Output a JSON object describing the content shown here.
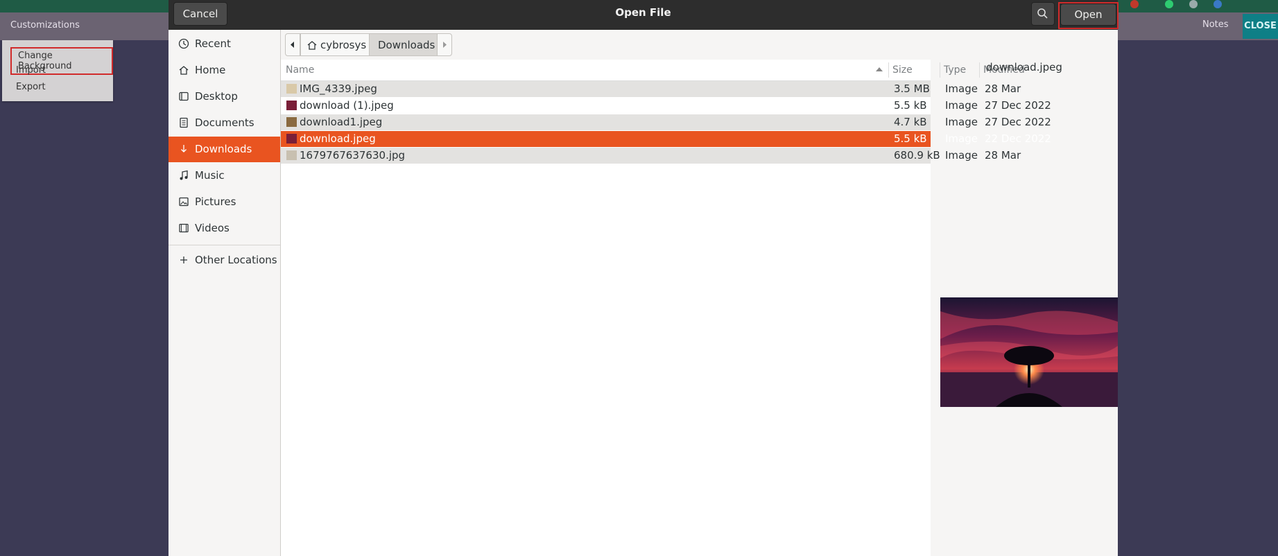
{
  "background_app": {
    "app_title": "Customizations",
    "notes_label": "Notes",
    "close_label": "CLOSE",
    "menu": {
      "items": [
        "Change Background",
        "Import",
        "Export"
      ]
    }
  },
  "dialog": {
    "title": "Open File",
    "cancel_label": "Cancel",
    "open_label": "Open",
    "search_icon": "search-icon",
    "sidebar": {
      "items": [
        {
          "label": "Recent",
          "icon": "clock-icon"
        },
        {
          "label": "Home",
          "icon": "home-icon"
        },
        {
          "label": "Desktop",
          "icon": "desktop-icon"
        },
        {
          "label": "Documents",
          "icon": "document-icon"
        },
        {
          "label": "Downloads",
          "icon": "download-icon",
          "active": true
        },
        {
          "label": "Music",
          "icon": "music-icon"
        },
        {
          "label": "Pictures",
          "icon": "picture-icon"
        },
        {
          "label": "Videos",
          "icon": "video-icon"
        },
        {
          "label": "Other Locations",
          "icon": "plus-icon"
        }
      ]
    },
    "pathbar": {
      "segments": [
        "cybrosys",
        "Downloads"
      ],
      "current": "Downloads"
    },
    "columns": {
      "name": "Name",
      "size": "Size",
      "type": "Type",
      "modified": "Modified"
    },
    "files": [
      {
        "name": "IMG_4339.jpeg",
        "size": "3.5 MB",
        "type": "Image",
        "modified": "28 Mar"
      },
      {
        "name": "download (1).jpeg",
        "size": "5.5 kB",
        "type": "Image",
        "modified": "27 Dec 2022"
      },
      {
        "name": "download1.jpeg",
        "size": "4.7 kB",
        "type": "Image",
        "modified": "27 Dec 2022"
      },
      {
        "name": "download.jpeg",
        "size": "5.5 kB",
        "type": "Image",
        "modified": "22 Dec 2022",
        "selected": true
      },
      {
        "name": "1679767637630.jpg",
        "size": "680.9 kB",
        "type": "Image",
        "modified": "28 Mar"
      }
    ],
    "preview": {
      "filename": "download.jpeg"
    }
  },
  "colors": {
    "accent": "#e95420",
    "highlight_border": "#d12b2b",
    "header_bg": "#2d2d2d"
  }
}
